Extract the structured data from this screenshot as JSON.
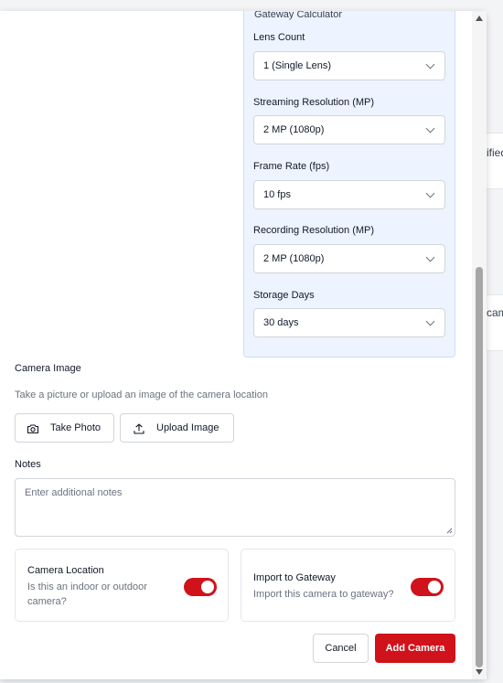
{
  "background": {
    "rows": [
      {
        "text": "ified"
      },
      {
        "text": "cam"
      }
    ]
  },
  "calculator": {
    "title": "Gateway Calculator",
    "fields": [
      {
        "label": "Lens Count",
        "value": "1 (Single Lens)"
      },
      {
        "label": "Streaming Resolution (MP)",
        "value": "2 MP (1080p)"
      },
      {
        "label": "Frame Rate (fps)",
        "value": "10 fps"
      },
      {
        "label": "Recording Resolution (MP)",
        "value": "2 MP (1080p)"
      },
      {
        "label": "Storage Days",
        "value": "30 days"
      }
    ]
  },
  "camera_image": {
    "label": "Camera Image",
    "helper": "Take a picture or upload an image of the camera location",
    "take_photo_label": "Take Photo",
    "upload_image_label": "Upload Image"
  },
  "notes": {
    "label": "Notes",
    "placeholder": "Enter additional notes"
  },
  "camera_location": {
    "title": "Camera Location",
    "description": "Is this an indoor or outdoor camera?",
    "enabled": true
  },
  "import_gateway": {
    "title": "Import to Gateway",
    "description": "Import this camera to gateway?",
    "enabled": true
  },
  "footer": {
    "cancel_label": "Cancel",
    "submit_label": "Add Camera"
  },
  "colors": {
    "accent": "#d0121b",
    "calc_bg": "#eef4ff"
  }
}
